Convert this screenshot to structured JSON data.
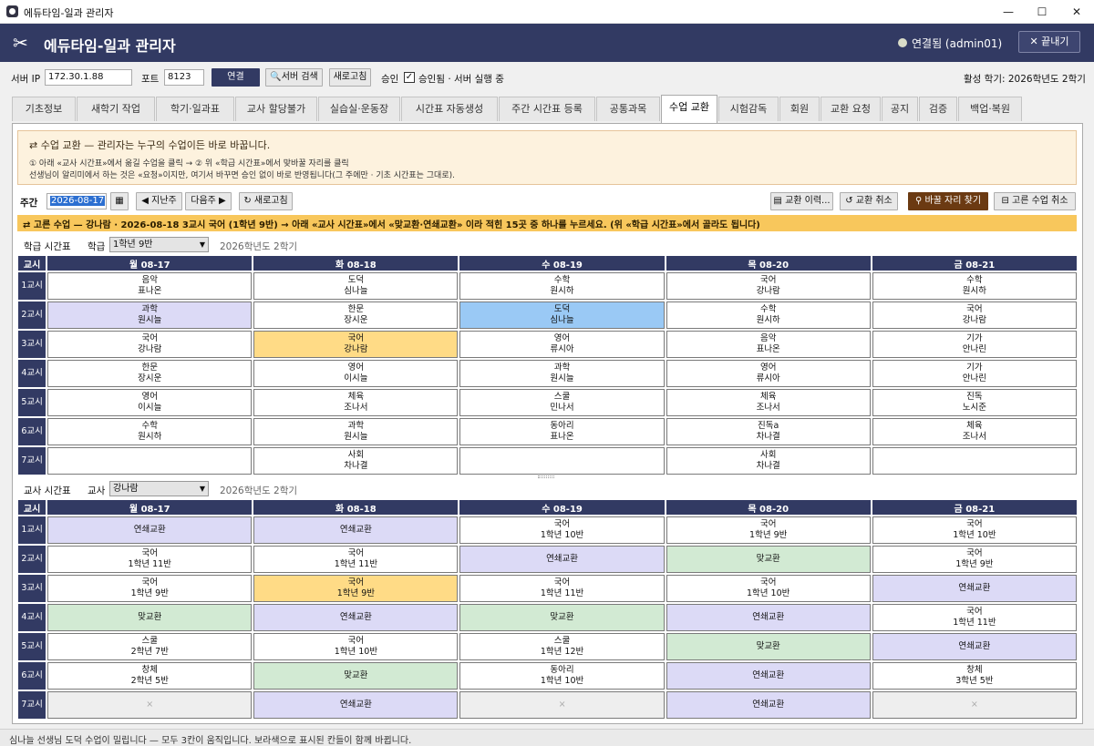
{
  "window": {
    "title": "에듀타임-일과 관리자",
    "min": "—",
    "max": "☐",
    "close": "✕"
  },
  "header": {
    "logo": "✂",
    "title": "에듀타임-일과 관리자",
    "status": "연결됨 (admin01)",
    "quit": "✕ 끝내기"
  },
  "server": {
    "ip_label": "서버 IP",
    "ip": "172.30.1.88",
    "port_label": "포트",
    "port": "8123",
    "connect": "연결",
    "search": "서버 검색",
    "refresh": "새로고침",
    "approval_label": "승인",
    "approval_check": "✓",
    "approval_text": "승인됨 · 서버 실행 중",
    "term": "활성 학기: 2026학년도 2학기"
  },
  "tabs": [
    "기초정보",
    "새학기 작업",
    "학기·일과표",
    "교사 할당불가",
    "실습실·운동장",
    "시간표 자동생성",
    "주간 시간표 등록",
    "공통과목",
    "수업 교환",
    "시험감독",
    "회원",
    "교환 요청",
    "공지",
    "검증",
    "백업·복원"
  ],
  "notice": {
    "title": "수업 교환 — 관리자는 누구의 수업이든 바로 바꿉니다.",
    "line1": "① 아래 «교사 시간표»에서 옮길 수업을 클릭   →   ② 위 «학급 시간표»에서 맞바꿀 자리를 클릭",
    "line2": "선생님이 알리미에서 하는 것은 «요청»이지만, 여기서 바꾸면 승인 없이 바로 반영됩니다(그 주에만 · 기초 시간표는 그대로)."
  },
  "week": {
    "label": "주간",
    "date": "2026-08-17",
    "prev": "◀ 지난주",
    "next": "다음주 ▶",
    "refresh": "↻ 새로고침",
    "history": "교환 이력...",
    "undo": "↺ 교환 취소",
    "find": "바꿀 자리 찾기",
    "cancel": "고른 수업 취소"
  },
  "banner": "고른 수업 — 강나람 · 2026-08-18 3교시 국어 (1학년 9반)   → 아래 «교사 시간표»에서 «맞교환·연쇄교환» 이라 적힌 15곳 중 하나를 누르세요. (위 «학급 시간표»에서 골라도 됩니다)",
  "class_tt": {
    "label": "학급 시간표",
    "sub": "학급",
    "value": "1학년 9반",
    "term": "2026학년도 2학기",
    "headers": [
      "교시",
      "월 08-17",
      "화 08-18",
      "수 08-19",
      "목 08-20",
      "금 08-21"
    ],
    "rows": [
      {
        "p": "1교시",
        "c": [
          [
            "음악",
            "표나온",
            ""
          ],
          [
            "도덕",
            "심나늘",
            ""
          ],
          [
            "수학",
            "원시하",
            ""
          ],
          [
            "국어",
            "강나람",
            ""
          ],
          [
            "수학",
            "원시하",
            ""
          ]
        ]
      },
      {
        "p": "2교시",
        "c": [
          [
            "과학",
            "원시늘",
            "lav"
          ],
          [
            "한문",
            "장시운",
            ""
          ],
          [
            "도덕",
            "심나늘",
            "blu"
          ],
          [
            "수학",
            "원시하",
            ""
          ],
          [
            "국어",
            "강나람",
            ""
          ]
        ]
      },
      {
        "p": "3교시",
        "c": [
          [
            "국어",
            "강나람",
            ""
          ],
          [
            "국어",
            "강나람",
            "sel"
          ],
          [
            "영어",
            "류시아",
            ""
          ],
          [
            "음악",
            "표나온",
            ""
          ],
          [
            "기가",
            "안나린",
            ""
          ]
        ]
      },
      {
        "p": "4교시",
        "c": [
          [
            "한문",
            "장시운",
            ""
          ],
          [
            "영어",
            "이시늘",
            ""
          ],
          [
            "과학",
            "원시늘",
            ""
          ],
          [
            "영어",
            "류시아",
            ""
          ],
          [
            "기가",
            "안나린",
            ""
          ]
        ]
      },
      {
        "p": "5교시",
        "c": [
          [
            "영어",
            "이시늘",
            ""
          ],
          [
            "체육",
            "조나서",
            ""
          ],
          [
            "스쿨",
            "민나서",
            ""
          ],
          [
            "체육",
            "조나서",
            ""
          ],
          [
            "진독",
            "노시준",
            ""
          ]
        ]
      },
      {
        "p": "6교시",
        "c": [
          [
            "수학",
            "원시하",
            ""
          ],
          [
            "과학",
            "원시늘",
            ""
          ],
          [
            "동아리",
            "표나온",
            ""
          ],
          [
            "진독a",
            "차나결",
            ""
          ],
          [
            "체육",
            "조나서",
            ""
          ]
        ]
      },
      {
        "p": "7교시",
        "c": [
          [
            "",
            "",
            ""
          ],
          [
            "사회",
            "차나결",
            ""
          ],
          [
            "",
            "",
            ""
          ],
          [
            "사회",
            "차나결",
            ""
          ],
          [
            "",
            "",
            ""
          ]
        ]
      }
    ]
  },
  "teacher_tt": {
    "label": "교사 시간표",
    "sub": "교사",
    "value": "강나람",
    "term": "2026학년도 2학기",
    "headers": [
      "교시",
      "월 08-17",
      "화 08-18",
      "수 08-19",
      "목 08-20",
      "금 08-21"
    ],
    "rows": [
      {
        "p": "1교시",
        "c": [
          [
            "연쇄교환",
            "",
            "lav"
          ],
          [
            "연쇄교환",
            "",
            "lav"
          ],
          [
            "국어",
            "1학년 10반",
            ""
          ],
          [
            "국어",
            "1학년 9반",
            ""
          ],
          [
            "국어",
            "1학년 10반",
            ""
          ]
        ]
      },
      {
        "p": "2교시",
        "c": [
          [
            "국어",
            "1학년 11반",
            ""
          ],
          [
            "국어",
            "1학년 11반",
            ""
          ],
          [
            "연쇄교환",
            "",
            "lav"
          ],
          [
            "맞교환",
            "",
            "grn"
          ],
          [
            "국어",
            "1학년 9반",
            ""
          ]
        ]
      },
      {
        "p": "3교시",
        "c": [
          [
            "국어",
            "1학년 9반",
            ""
          ],
          [
            "국어",
            "1학년 9반",
            "sel"
          ],
          [
            "국어",
            "1학년 11반",
            ""
          ],
          [
            "국어",
            "1학년 10반",
            ""
          ],
          [
            "연쇄교환",
            "",
            "lav"
          ]
        ]
      },
      {
        "p": "4교시",
        "c": [
          [
            "맞교환",
            "",
            "grn"
          ],
          [
            "연쇄교환",
            "",
            "lav"
          ],
          [
            "맞교환",
            "",
            "grn"
          ],
          [
            "연쇄교환",
            "",
            "lav"
          ],
          [
            "국어",
            "1학년 11반",
            ""
          ]
        ]
      },
      {
        "p": "5교시",
        "c": [
          [
            "스쿨",
            "2학년 7반",
            ""
          ],
          [
            "국어",
            "1학년 10반",
            ""
          ],
          [
            "스쿨",
            "1학년 12반",
            ""
          ],
          [
            "맞교환",
            "",
            "grn"
          ],
          [
            "연쇄교환",
            "",
            "lav"
          ]
        ]
      },
      {
        "p": "6교시",
        "c": [
          [
            "창체",
            "2학년 5반",
            ""
          ],
          [
            "맞교환",
            "",
            "grn"
          ],
          [
            "동아리",
            "1학년 10반",
            ""
          ],
          [
            "연쇄교환",
            "",
            "lav"
          ],
          [
            "창체",
            "3학년 5반",
            ""
          ]
        ]
      },
      {
        "p": "7교시",
        "c": [
          [
            "×",
            "",
            "gray"
          ],
          [
            "연쇄교환",
            "",
            "lav"
          ],
          [
            "×",
            "",
            "gray"
          ],
          [
            "연쇄교환",
            "",
            "lav"
          ],
          [
            "×",
            "",
            "gray"
          ]
        ]
      }
    ]
  },
  "status": "심나늘 선생님 도덕 수업이 밀립니다 — 모두 3칸이 움직입니다.  보라색으로 표시된 칸들이 함께 바뀝니다.",
  "colors": {
    "navy": "#323a63",
    "selected": "#ffdb86",
    "blue": "#9ac9f5",
    "lavender": "#dcdaf6",
    "green": "#d2ead3",
    "banner": "#f8c75c"
  }
}
